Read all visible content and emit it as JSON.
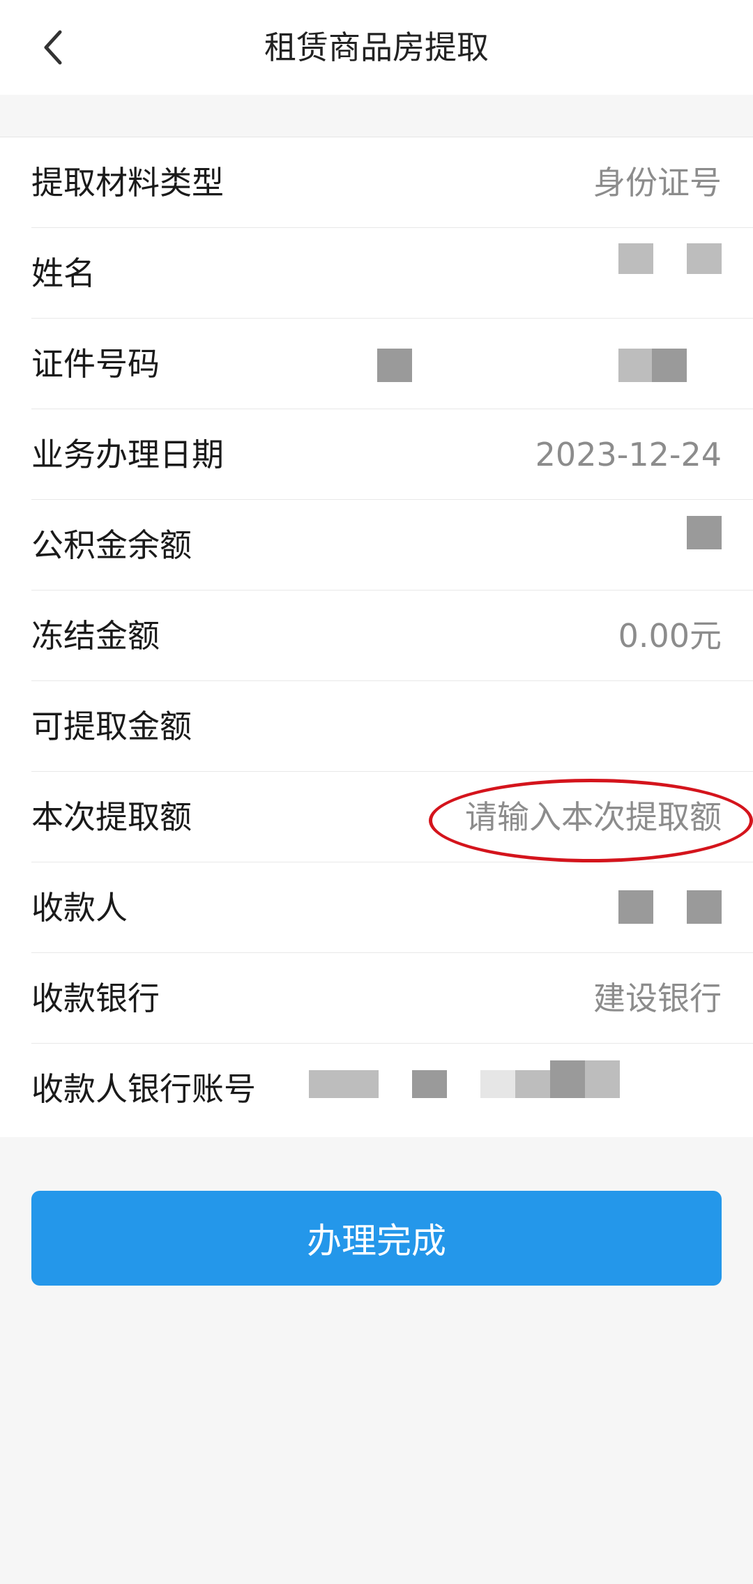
{
  "header": {
    "title": "租赁商品房提取",
    "back_icon": "chevron-left-icon"
  },
  "form": {
    "rows": [
      {
        "label": "提取材料类型",
        "value": "身份证号"
      },
      {
        "label": "姓名",
        "value": ""
      },
      {
        "label": "证件号码",
        "value": ""
      },
      {
        "label": "业务办理日期",
        "value": "2023-12-24"
      },
      {
        "label": "公积金余额",
        "value": ""
      },
      {
        "label": "冻结金额",
        "value": "0.00元"
      },
      {
        "label": "可提取金额",
        "value": ""
      },
      {
        "label": "本次提取额",
        "placeholder": "请输入本次提取额",
        "value": ""
      },
      {
        "label": "收款人",
        "value": ""
      },
      {
        "label": "收款银行",
        "value": "建设银行"
      },
      {
        "label": "收款人银行账号",
        "value": ""
      }
    ]
  },
  "actions": {
    "submit_label": "办理完成"
  },
  "colors": {
    "primary": "#2497ea",
    "highlight": "#d4141c",
    "value_text": "#8c8c8c"
  }
}
